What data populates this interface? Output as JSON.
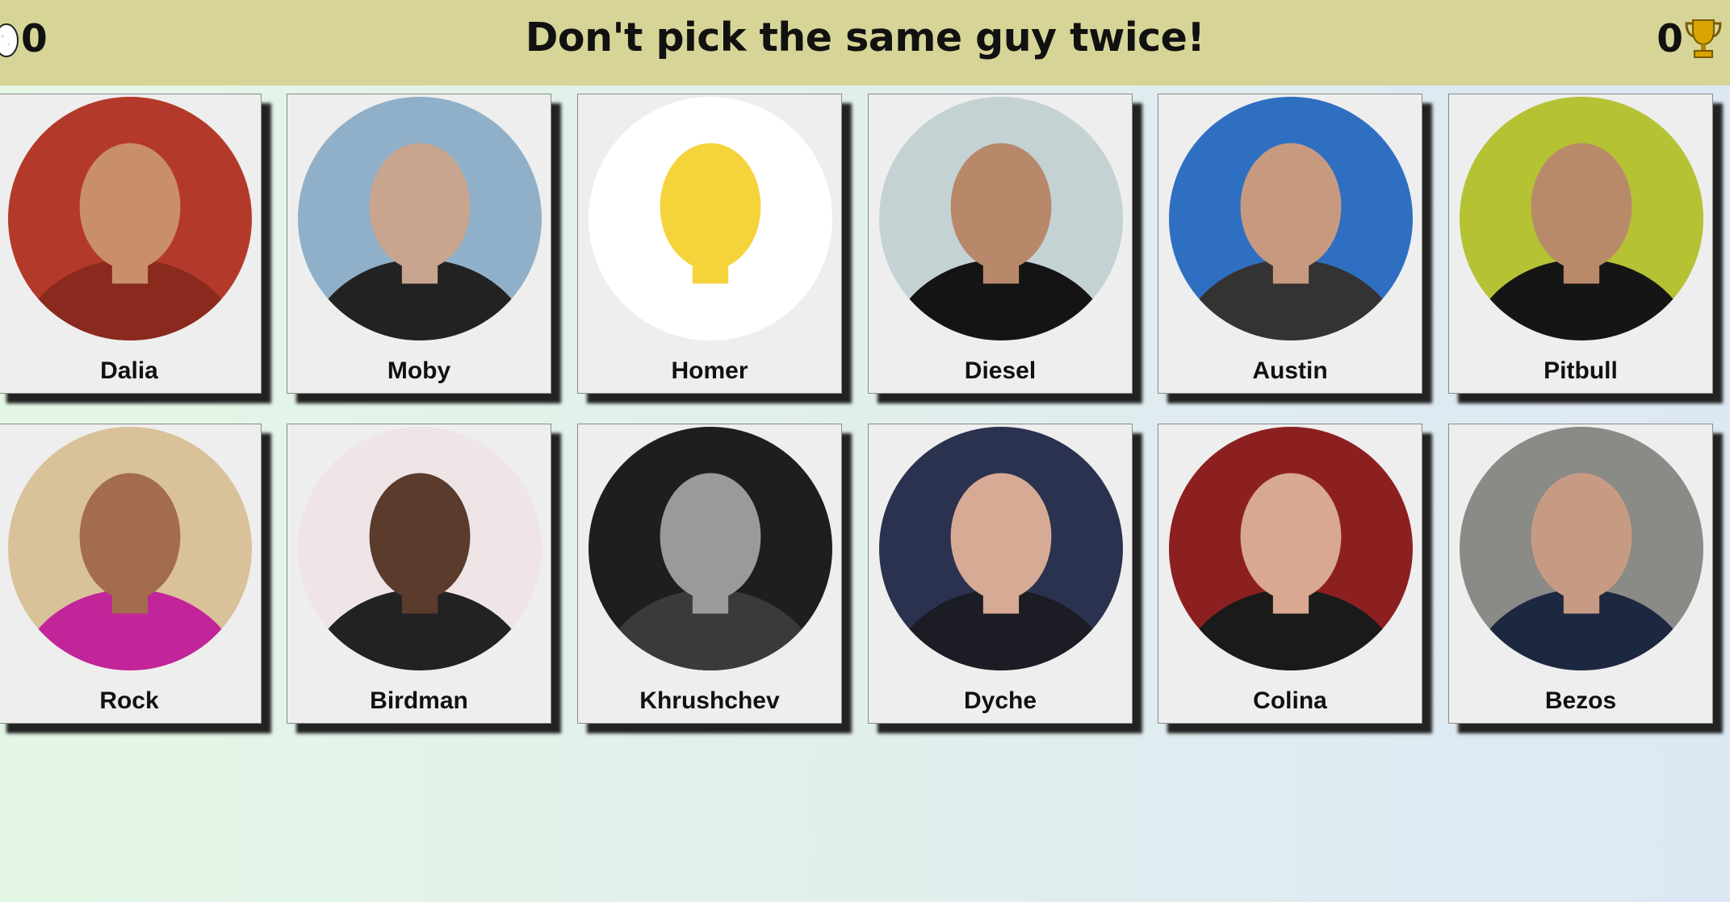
{
  "header": {
    "title": "Don't pick the same guy twice!",
    "current_score": "0",
    "best_score": "0",
    "current_icon": "egg-icon",
    "best_icon": "trophy-icon",
    "bar_color": "#d6d597"
  },
  "cards": [
    {
      "name": "Dalia",
      "bg": "#b33a2a",
      "fg": "#c98f6a",
      "cloth": "#8a2a1e"
    },
    {
      "name": "Moby",
      "bg": "#8fb0c8",
      "fg": "#c9a58f",
      "cloth": "#222222"
    },
    {
      "name": "Homer",
      "bg": "#ffffff",
      "fg": "#f5d33a",
      "cloth": "#ffffff"
    },
    {
      "name": "Diesel",
      "bg": "#c4d2d4",
      "fg": "#b8886a",
      "cloth": "#141414"
    },
    {
      "name": "Austin",
      "bg": "#2f6fc1",
      "fg": "#c79a80",
      "cloth": "#333333"
    },
    {
      "name": "Pitbull",
      "bg": "#b5c234",
      "fg": "#b98a6a",
      "cloth": "#151515"
    },
    {
      "name": "Rock",
      "bg": "#d9c19a",
      "fg": "#a36c4e",
      "cloth": "#c2249a"
    },
    {
      "name": "Birdman",
      "bg": "#efe4e6",
      "fg": "#5a3b2c",
      "cloth": "#222222"
    },
    {
      "name": "Khrushchev",
      "bg": "#1e1e1e",
      "fg": "#9a9a9a",
      "cloth": "#3a3a3a"
    },
    {
      "name": "Dyche",
      "bg": "#2a3250",
      "fg": "#d6aa94",
      "cloth": "#1c1c24"
    },
    {
      "name": "Colina",
      "bg": "#8c2020",
      "fg": "#d8a890",
      "cloth": "#1a1a1a"
    },
    {
      "name": "Bezos",
      "bg": "#8a8a86",
      "fg": "#c79b83",
      "cloth": "#1c2840"
    }
  ]
}
